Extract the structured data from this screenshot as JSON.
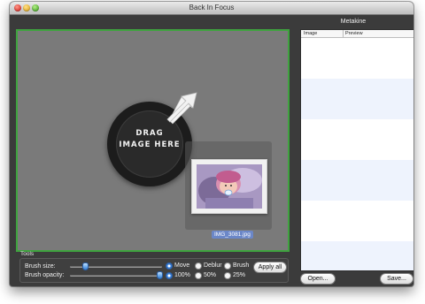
{
  "window": {
    "title": "Back In Focus"
  },
  "canvas": {
    "drop_line1": "DRAG",
    "drop_line2": "IMAGE HERE",
    "dragged_file": "IMG_3081.jpg",
    "frame_color": "#3fa33f"
  },
  "tools": {
    "title": "Tools",
    "brush_size_label": "Brush size:",
    "brush_size_value": 0.15,
    "brush_opacity_label": "Brush opacity:",
    "brush_opacity_value": 1.0,
    "modes": {
      "move": "Move",
      "deblur": "Deblur",
      "brush": "Brush",
      "selected": "Move"
    },
    "opacities": {
      "p100": "100%",
      "p50": "50%",
      "p25": "25%",
      "selected": "100%"
    },
    "apply_all": "Apply all"
  },
  "metakine": {
    "title": "Metakine",
    "columns": [
      "Image",
      "Preview"
    ],
    "open_label": "Open...",
    "save_label": "Save..."
  }
}
